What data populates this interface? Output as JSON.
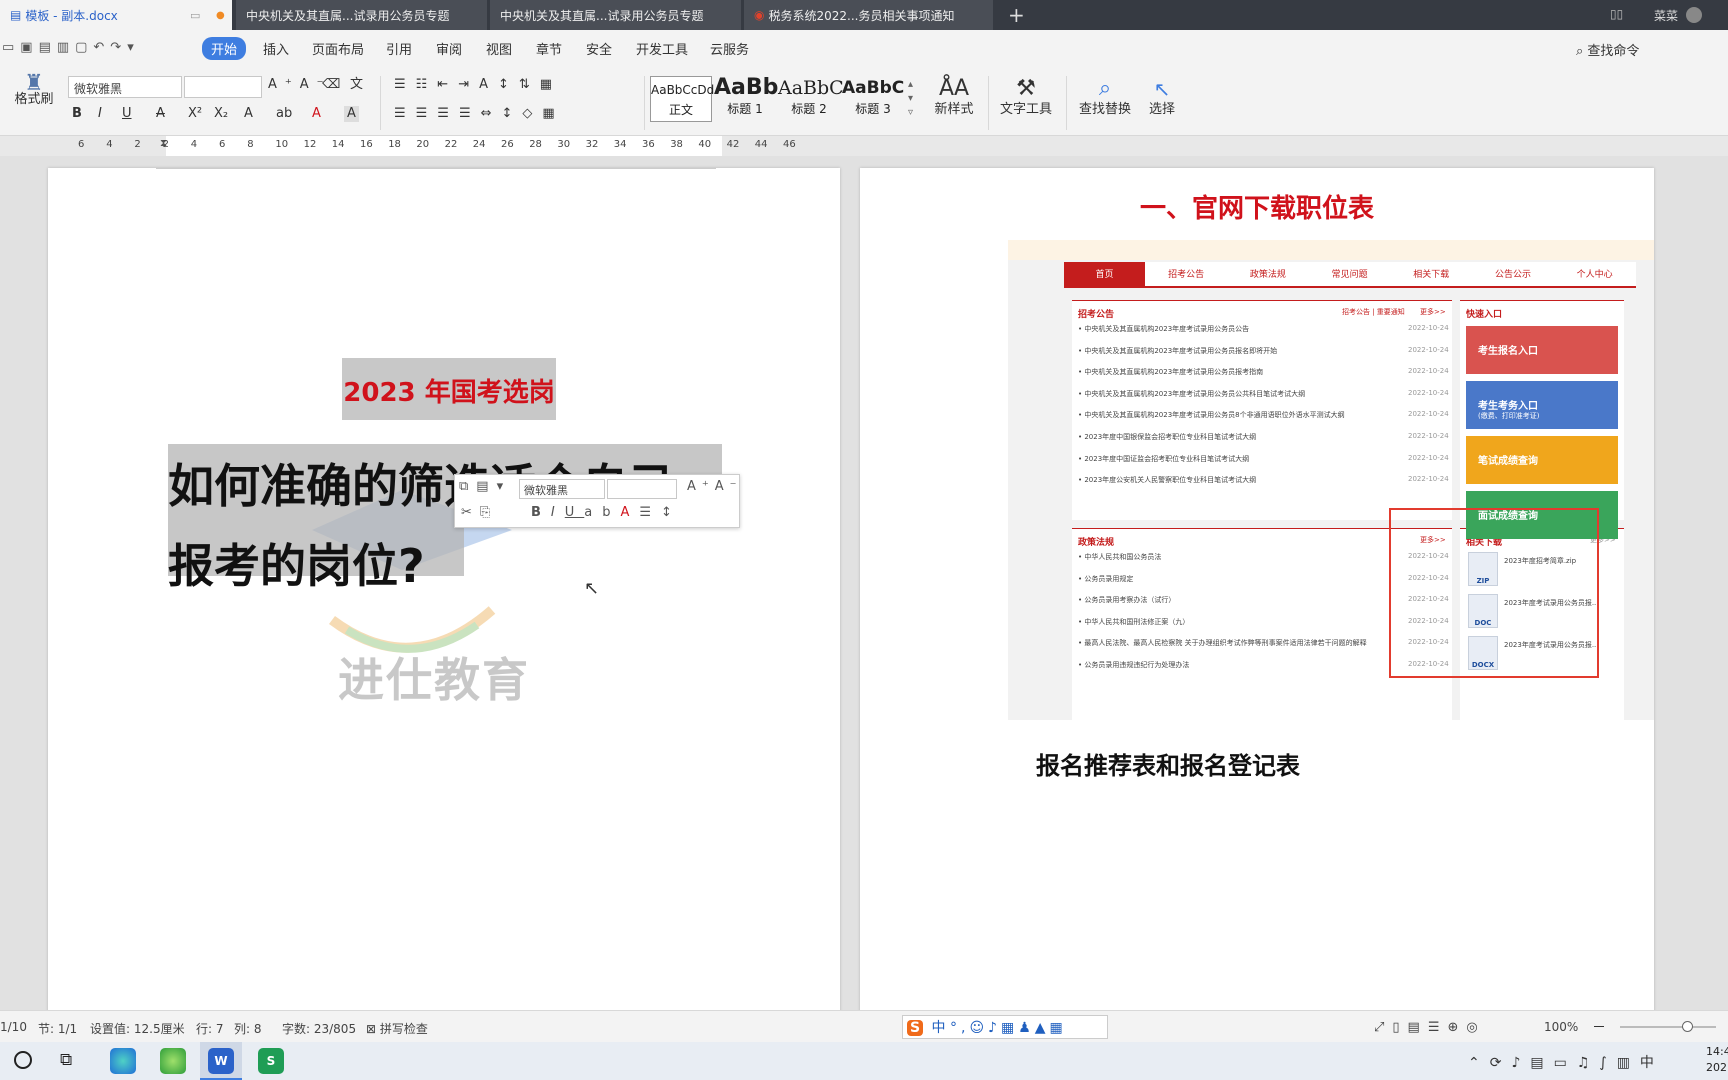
{
  "window": {
    "tabs": [
      {
        "label": "模板 - 副本.docx"
      },
      {
        "label": "中央机关及其直属...试录用公务员专题"
      },
      {
        "label": "中央机关及其直属...试录用公务员专题"
      },
      {
        "label": "税务系统2022...务员相关事项通知"
      }
    ],
    "new_tab": "+",
    "user": "菜菜"
  },
  "menu": {
    "items": [
      "开始",
      "插入",
      "页面布局",
      "引用",
      "审阅",
      "视图",
      "章节",
      "安全",
      "开发工具",
      "云服务"
    ],
    "search": "查找命令"
  },
  "toolbar": {
    "format_painter": "格式刷",
    "font_name": "微软雅黑",
    "font_size": "",
    "styles": [
      {
        "preview": "AaBbCcDd",
        "label": "正文"
      },
      {
        "preview": "AaBb",
        "label": "标题 1"
      },
      {
        "preview": "AaBbC",
        "label": "标题 2"
      },
      {
        "preview": "AaBbC",
        "label": "标题 3"
      }
    ],
    "new_style": "新样式",
    "text_tools": "文字工具",
    "find_replace": "查找替换",
    "select": "选择"
  },
  "ruler": {
    "ticks": [
      "6",
      "4",
      "2",
      "2",
      "4",
      "6",
      "8",
      "10",
      "12",
      "14",
      "16",
      "18",
      "20",
      "22",
      "24",
      "26",
      "28",
      "30",
      "32",
      "34",
      "36",
      "38",
      "40",
      "42",
      "44",
      "46"
    ]
  },
  "doc": {
    "left_page": {
      "subtitle": "2023 年国考选岗",
      "title_line1": "如何准确的筛选适合自己",
      "title_line2": "报考的岗位?",
      "watermark": "进仕教育"
    },
    "right_page": {
      "heading": "一、官网下载职位表",
      "caption": "报名推荐表和报名登记表"
    },
    "mini_toolbar": {
      "font": "微软雅黑"
    },
    "site": {
      "nav": [
        "首页",
        "招考公告",
        "政策法规",
        "常见问题",
        "相关下载",
        "公告公示",
        "个人中心"
      ],
      "notice_title": "招考公告",
      "notice_links": "招考公告 | 重要通知",
      "more": "更多>>",
      "notices": [
        {
          "text": "中央机关及其直属机构2023年度考试录用公务员公告",
          "date": "2022-10-24"
        },
        {
          "text": "中央机关及其直属机构2023年度考试录用公务员报名即将开始",
          "date": "2022-10-24"
        },
        {
          "text": "中央机关及其直属机构2023年度考试录用公务员报考指南",
          "date": "2022-10-24"
        },
        {
          "text": "中央机关及其直属机构2023年度考试录用公务员公共科目笔试考试大纲",
          "date": "2022-10-24"
        },
        {
          "text": "中央机关及其直属机构2023年度考试录用公务员8个非通用语职位外语水平测试大纲",
          "date": "2022-10-24"
        },
        {
          "text": "2023年度中国银保监会招考职位专业科目笔试考试大纲",
          "date": "2022-10-24"
        },
        {
          "text": "2023年度中国证监会招考职位专业科目笔试考试大纲",
          "date": "2022-10-24"
        },
        {
          "text": "2023年度公安机关人民警察职位专业科目笔试考试大纲",
          "date": "2022-10-24"
        }
      ],
      "quick_title": "快速入口",
      "quick": [
        "考生报名入口",
        "考生考务入口",
        "笔试成绩查询",
        "面试成绩查询"
      ],
      "quick_sub": "(缴费、打印准考证)",
      "policy_title": "政策法规",
      "policy_more": "更多>>",
      "policies": [
        {
          "text": "中华人民共和国公务员法",
          "date": "2022-10-24"
        },
        {
          "text": "公务员录用规定",
          "date": "2022-10-24"
        },
        {
          "text": "公务员录用考察办法（试行）",
          "date": "2022-10-24"
        },
        {
          "text": "中华人民共和国刑法修正案（九）",
          "date": "2022-10-24"
        },
        {
          "text": "最高人民法院、最高人民检察院 关于办理组织考试作弊等刑事案件适用法律若干问题的解释",
          "date": "2022-10-24"
        },
        {
          "text": "公务员录用违规违纪行为处理办法",
          "date": "2022-10-24"
        }
      ],
      "download_title": "相关下载",
      "download_more": "更多>>",
      "downloads": [
        {
          "name": "2023年度招考简章.zip",
          "type": "ZIP"
        },
        {
          "name": "2023年度考试录用公务员报...",
          "type": "DOC"
        },
        {
          "name": "2023年度考试录用公务员报...",
          "type": "DOCX"
        }
      ]
    }
  },
  "status": {
    "page": "1/10",
    "section": "节: 1/1",
    "setting": "设置值: 12.5厘米",
    "row": "行: 7",
    "col": "列: 8",
    "words": "字数: 23/805",
    "spell": "拼写检查",
    "zoom": "100%"
  },
  "ime": {
    "label": "中"
  },
  "taskbar": {
    "time": "14:4",
    "date": "202"
  },
  "colors": {
    "accent": "#3e7de0",
    "red": "#d0121b",
    "site_red": "#c41d1d"
  }
}
